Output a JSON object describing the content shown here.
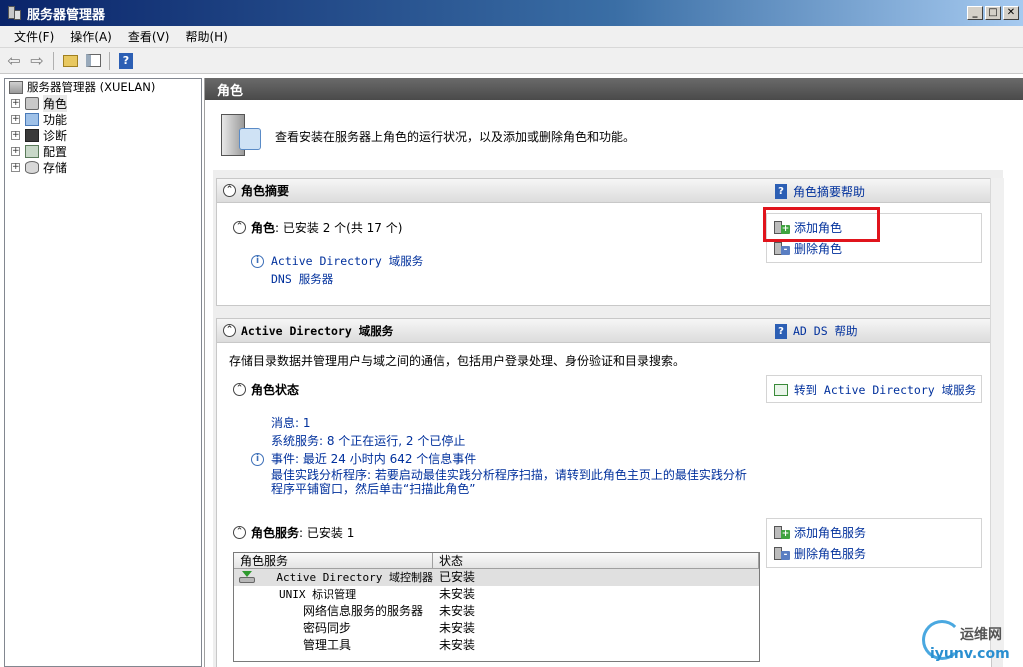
{
  "window": {
    "title": "服务器管理器"
  },
  "menu": [
    "文件(F)",
    "操作(A)",
    "查看(V)",
    "帮助(H)"
  ],
  "toolbar": {
    "back": "⇦",
    "forward": "⇨",
    "help": "?"
  },
  "tree": {
    "root": "服务器管理器 (XUELAN)",
    "nodes": [
      {
        "label": "角色",
        "icon": "roles-icon"
      },
      {
        "label": "功能",
        "icon": "features-icon"
      },
      {
        "label": "诊断",
        "icon": "diagnostics-icon"
      },
      {
        "label": "配置",
        "icon": "configuration-icon"
      },
      {
        "label": "存储",
        "icon": "storage-icon"
      }
    ]
  },
  "panel": {
    "title": "角色",
    "intro": "查看安装在服务器上角色的运行状况，以及添加或删除角色和功能。"
  },
  "summary": {
    "title": "角色摘要",
    "help": "角色摘要帮助",
    "roles_label": "角色",
    "roles_count": ": 已安装 2 个(共 17 个)",
    "installed": [
      "Active Directory 域服务",
      "DNS 服务器"
    ],
    "add_role": "添加角色",
    "remove_role": "删除角色"
  },
  "adds": {
    "title": "Active Directory 域服务",
    "help": "AD DS 帮助",
    "description": "存储目录数据并管理用户与域之间的通信，包括用户登录处理、身份验证和目录搜索。",
    "status_title": "角色状态",
    "goto": "转到 Active Directory 域服务",
    "messages": "消息: 1",
    "services": "系统服务: 8 个正在运行, 2 个已停止",
    "events": "事件: 最近 24 小时内 642 个信息事件",
    "bpa_line1": "最佳实践分析程序: 若要启动最佳实践分析程序扫描，请转到此角色主页上的最佳实践分析",
    "bpa_line2": "程序平铺窗口，然后单击“扫描此角色”",
    "role_services_title": "角色服务",
    "role_services_count": ": 已安装 1",
    "add_service": "添加角色服务",
    "remove_service": "删除角色服务",
    "table": {
      "col_name": "角色服务",
      "col_status": "状态",
      "rows": [
        {
          "name": "Active Directory 域控制器",
          "status": "已安装",
          "indent": 0
        },
        {
          "name": "UNIX 标识管理",
          "status": "未安装",
          "indent": 0
        },
        {
          "name": "网络信息服务的服务器",
          "status": "未安装",
          "indent": 1
        },
        {
          "name": "密码同步",
          "status": "未安装",
          "indent": 1
        },
        {
          "name": "管理工具",
          "status": "未安装",
          "indent": 1
        }
      ]
    }
  },
  "watermark": {
    "line1": "运维网",
    "line2": "iyunv.com"
  }
}
